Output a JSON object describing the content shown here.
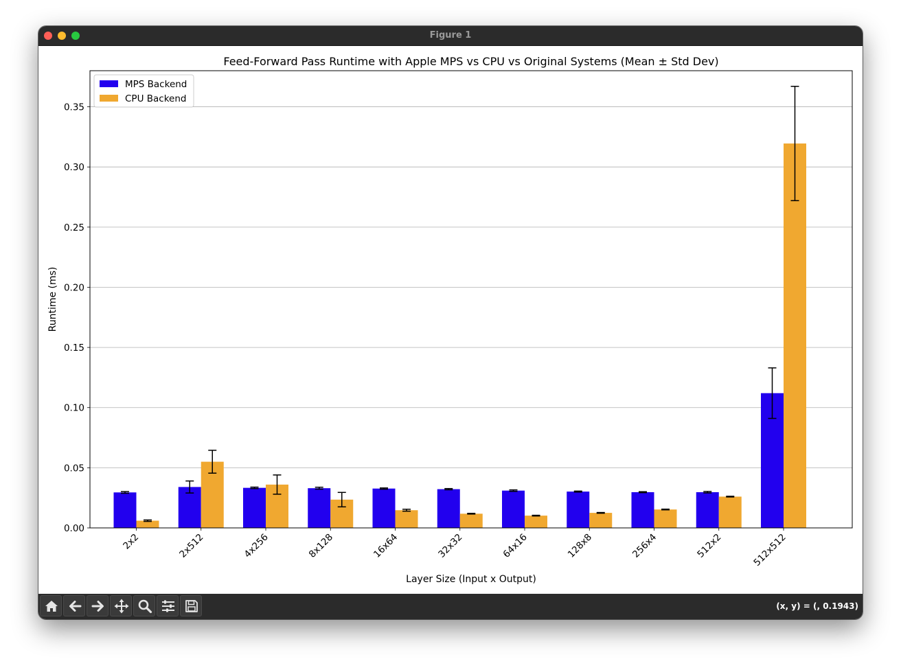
{
  "window": {
    "title": "Figure 1",
    "controls": {
      "close_color": "#ff5f57",
      "minimize_color": "#febc2e",
      "maximize_color": "#28c840"
    }
  },
  "toolbar": {
    "buttons": [
      {
        "name": "home",
        "icon": "home-icon"
      },
      {
        "name": "back",
        "icon": "arrow-left-icon"
      },
      {
        "name": "forward",
        "icon": "arrow-right-icon"
      },
      {
        "name": "pan",
        "icon": "move-icon"
      },
      {
        "name": "zoom",
        "icon": "magnifier-icon"
      },
      {
        "name": "configure-subplots",
        "icon": "sliders-icon"
      },
      {
        "name": "save",
        "icon": "floppy-disk-icon"
      }
    ],
    "coords": "(x, y) = (, 0.1943)"
  },
  "chart_data": {
    "type": "bar",
    "title": "Feed-Forward Pass Runtime with Apple MPS vs CPU vs Original Systems (Mean ± Std Dev)",
    "xlabel": "Layer Size (Input x Output)",
    "ylabel": "Runtime (ms)",
    "ylim": [
      0,
      0.38
    ],
    "yticks": [
      "0.00",
      "0.05",
      "0.10",
      "0.15",
      "0.20",
      "0.25",
      "0.30",
      "0.35"
    ],
    "ytick_values": [
      0,
      0.05,
      0.1,
      0.15,
      0.2,
      0.25,
      0.3,
      0.35
    ],
    "grid": "y",
    "legend_position": "top-left",
    "categories": [
      "2x2",
      "2x512",
      "4x256",
      "8x128",
      "16x64",
      "32x32",
      "64x16",
      "128x8",
      "256x4",
      "512x2",
      "512x512"
    ],
    "series": [
      {
        "name": "MPS Backend",
        "color": "#2200ee",
        "values": [
          0.0295,
          0.034,
          0.0333,
          0.033,
          0.0327,
          0.0322,
          0.031,
          0.0302,
          0.0297,
          0.0297,
          0.112
        ],
        "errors": [
          0.0007,
          0.005,
          0.0006,
          0.0008,
          0.0005,
          0.0005,
          0.0006,
          0.0004,
          0.0004,
          0.0006,
          0.021
        ]
      },
      {
        "name": "CPU Backend",
        "color": "#f0a830",
        "values": [
          0.006,
          0.055,
          0.036,
          0.0235,
          0.0147,
          0.0118,
          0.0102,
          0.0125,
          0.0153,
          0.026,
          0.3195
        ],
        "errors": [
          0.0006,
          0.0095,
          0.008,
          0.006,
          0.0008,
          0.0003,
          0.0003,
          0.0003,
          0.0003,
          0.0003,
          0.0475
        ]
      }
    ]
  }
}
